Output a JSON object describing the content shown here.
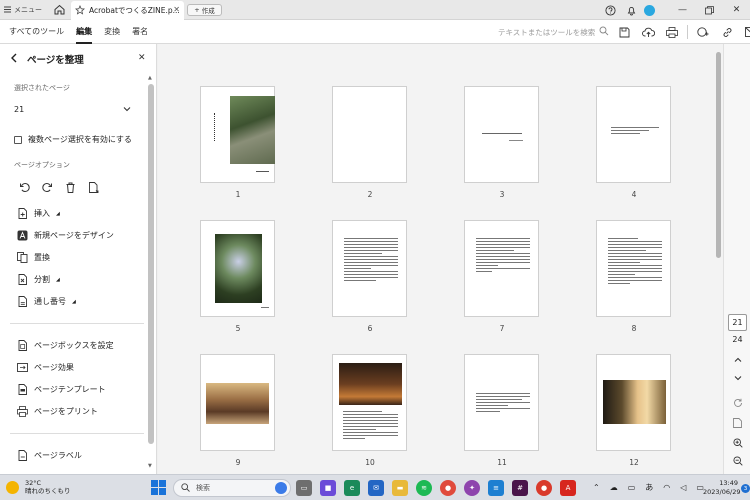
{
  "titlebar": {
    "menu_label": "メニュー",
    "tab_title": "AcrobatでつくるZINE.p...",
    "new_tab_label": "作成"
  },
  "toolbar": {
    "tabs": [
      {
        "label": "すべてのツール"
      },
      {
        "label": "編集"
      },
      {
        "label": "変換"
      },
      {
        "label": "署名"
      }
    ],
    "search_placeholder": "テキストまたはツールを検索"
  },
  "sidebar": {
    "title": "ページを整理",
    "selected_pages_label": "選択されたページ",
    "selected_pages_value": "21",
    "multi_select_label": "複数ページ選択を有効にする",
    "page_options_label": "ページオプション",
    "items": [
      {
        "label": "挿入"
      },
      {
        "label": "新規ページをデザイン"
      },
      {
        "label": "置換"
      },
      {
        "label": "分割"
      },
      {
        "label": "通し番号"
      },
      {
        "label": "ページボックスを設定"
      },
      {
        "label": "ページ効果"
      },
      {
        "label": "ページテンプレート"
      },
      {
        "label": "ページをプリント"
      },
      {
        "label": "ページラベル"
      }
    ]
  },
  "pages": [
    {
      "number": "1"
    },
    {
      "number": "2"
    },
    {
      "number": "3"
    },
    {
      "number": "4"
    },
    {
      "number": "5"
    },
    {
      "number": "6"
    },
    {
      "number": "7"
    },
    {
      "number": "8"
    },
    {
      "number": "9"
    },
    {
      "number": "10"
    },
    {
      "number": "11"
    },
    {
      "number": "12"
    }
  ],
  "page_nav": {
    "current_page": "21",
    "total_pages": "24"
  },
  "taskbar": {
    "temperature": "32°C",
    "weather": "晴れのちくもり",
    "search_placeholder": "検索",
    "ime": "あ",
    "time": "13:49",
    "date": "2023/06/29",
    "notification_count": "3"
  },
  "colors": {
    "accent": "#2aa8e0",
    "acrobat_red": "#d7261e"
  }
}
